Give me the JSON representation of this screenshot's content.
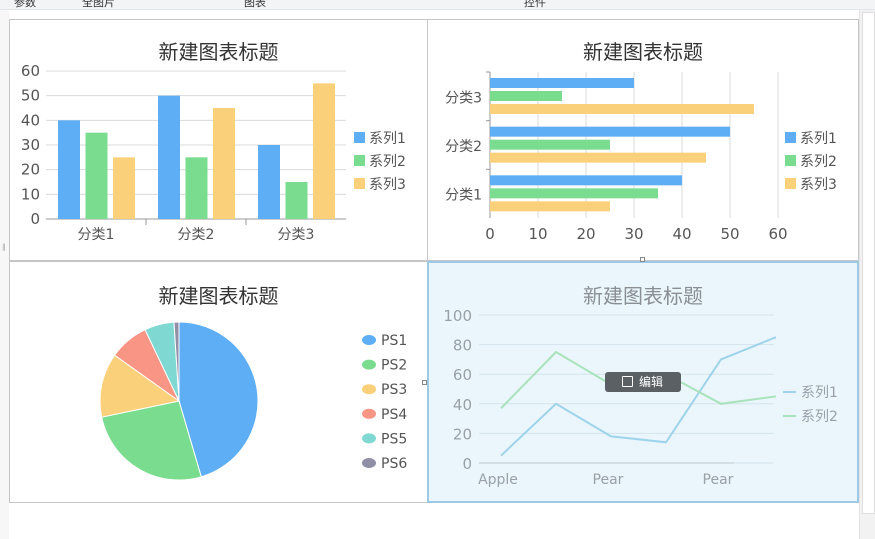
{
  "toolbar": {
    "labels": [
      "参数",
      "全图片",
      "图表",
      "控件"
    ]
  },
  "edit_button": {
    "label": "编辑"
  },
  "colors": {
    "series1": "#5eaef5",
    "series2": "#79dc8e",
    "series3": "#fbd07a",
    "ps1": "#5eaef5",
    "ps2": "#79dc8e",
    "ps3": "#fbd07a",
    "ps4": "#f99585",
    "ps5": "#7fd9d2",
    "ps6": "#8f8fa8",
    "selected_bg": "#eaf6fc"
  },
  "chart_data": [
    {
      "type": "bar",
      "title": "新建图表标题",
      "categories": [
        "分类1",
        "分类2",
        "分类3"
      ],
      "series": [
        {
          "name": "系列1",
          "values": [
            40,
            50,
            30
          ]
        },
        {
          "name": "系列2",
          "values": [
            35,
            25,
            15
          ]
        },
        {
          "name": "系列3",
          "values": [
            25,
            45,
            55
          ]
        }
      ],
      "ylim": [
        0,
        60
      ],
      "yticks": [
        "0",
        "10",
        "20",
        "30",
        "40",
        "50",
        "60"
      ],
      "grid": true,
      "legend": "right"
    },
    {
      "type": "bar",
      "orientation": "horizontal",
      "title": "新建图表标题",
      "categories": [
        "分类1",
        "分类2",
        "分类3"
      ],
      "series": [
        {
          "name": "系列1",
          "values": [
            40,
            50,
            30
          ]
        },
        {
          "name": "系列2",
          "values": [
            35,
            25,
            15
          ]
        },
        {
          "name": "系列3",
          "values": [
            25,
            45,
            55
          ]
        }
      ],
      "xlim": [
        0,
        60
      ],
      "xticks": [
        "0",
        "10",
        "20",
        "30",
        "40",
        "50",
        "60"
      ],
      "grid": true,
      "legend": "right"
    },
    {
      "type": "pie",
      "title": "新建图表标题",
      "labels": [
        "PS1",
        "PS2",
        "PS3",
        "PS4",
        "PS5",
        "PS6"
      ],
      "values": [
        45,
        26,
        13,
        8,
        6,
        1
      ],
      "legend": "right"
    },
    {
      "type": "line",
      "title": "新建图表标题",
      "xticklabels": [
        "Apple",
        "Pear",
        "Pear"
      ],
      "series": [
        {
          "name": "系列1",
          "values": [
            5,
            40,
            18,
            14,
            70,
            85
          ]
        },
        {
          "name": "系列2",
          "values": [
            37,
            75,
            53,
            60,
            40,
            45
          ]
        }
      ],
      "ylim": [
        0,
        100
      ],
      "yticks": [
        "0",
        "20",
        "40",
        "60",
        "80",
        "100"
      ],
      "grid": true,
      "legend": "right"
    }
  ]
}
